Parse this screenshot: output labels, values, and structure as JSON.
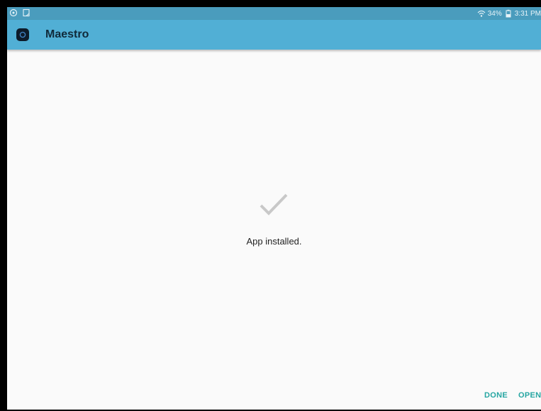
{
  "status_bar": {
    "battery": "34%",
    "time": "3:31 PM"
  },
  "app_bar": {
    "icon": "maestro-app-icon",
    "title": "Maestro"
  },
  "main": {
    "icon": "checkmark-icon",
    "message": "App installed."
  },
  "actions": {
    "done_label": "DONE",
    "open_label": "OPEN"
  },
  "colors": {
    "status_bar": "#4a9cbd",
    "app_bar": "#51afd5",
    "accent": "#26a6a2",
    "checkmark": "#c8c8c8"
  }
}
